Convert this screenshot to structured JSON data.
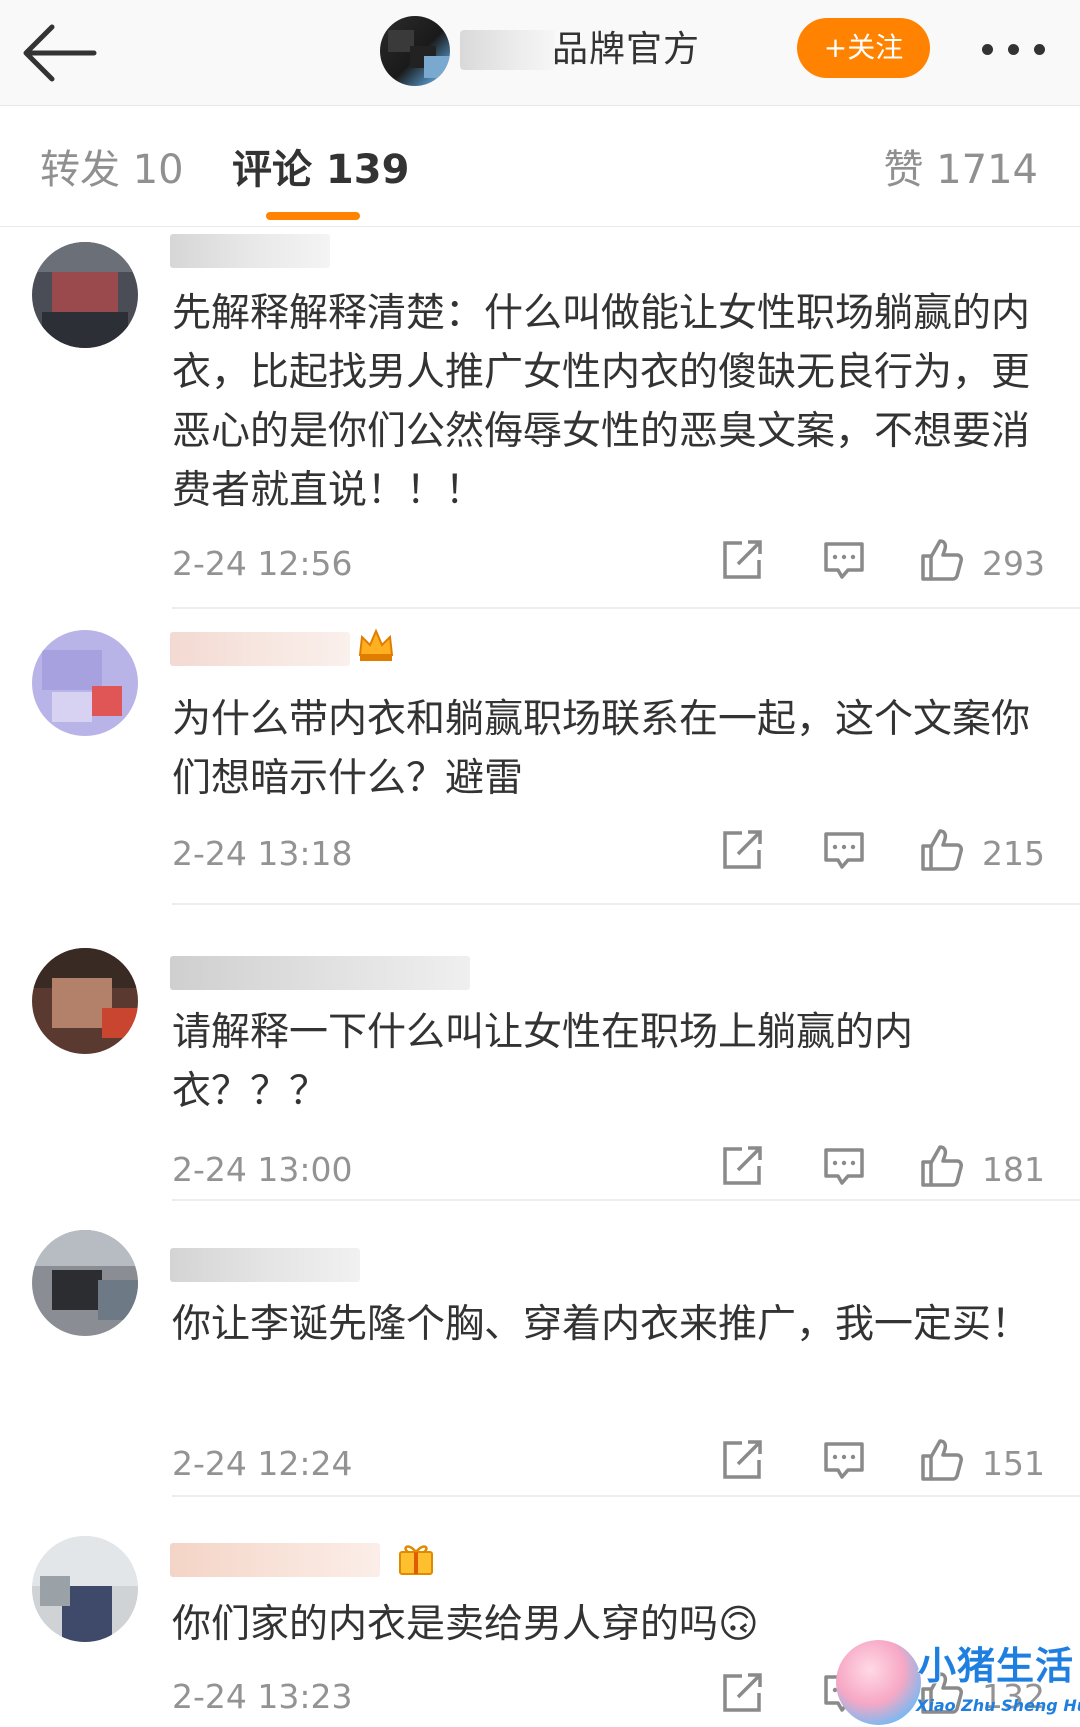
{
  "header": {
    "back_icon": "arrow-left-icon",
    "title": "品牌官方",
    "follow_label": "+关注",
    "more_icon": "ellipsis-icon",
    "accent_color": "#ff8200"
  },
  "tabs": {
    "repost": "转发 10",
    "comments": "评论 139",
    "likes": "赞 1714",
    "active": "comments"
  },
  "comments": [
    {
      "text": "先解释解释清楚：什么叫做能让女性职场躺赢的内衣，比起找男人推广女性内衣的傻缺无良行为，更恶心的是你们公然侮辱女性的恶臭文案，不想要消费者就直说！！！",
      "time": "2-24 12:56",
      "likes": "293"
    },
    {
      "text": "为什么带内衣和躺赢职场联系在一起，这个文案你们想暗示什么？避雷",
      "time": "2-24 13:18",
      "likes": "215"
    },
    {
      "text": "请解释一下什么叫让女性在职场上躺赢的内衣？？？",
      "time": "2-24 13:00",
      "likes": "181"
    },
    {
      "text": "你让李诞先隆个胸、穿着内衣来推广，我一定买！",
      "time": "2-24 12:24",
      "likes": "151"
    },
    {
      "text": "你们家的内衣是卖给男人穿的吗🙃",
      "time": "2-24 13:23",
      "likes": "132"
    }
  ],
  "watermark": {
    "title": "小猪生活",
    "subtitle": "Xiao Zhu Sheng Huo"
  }
}
